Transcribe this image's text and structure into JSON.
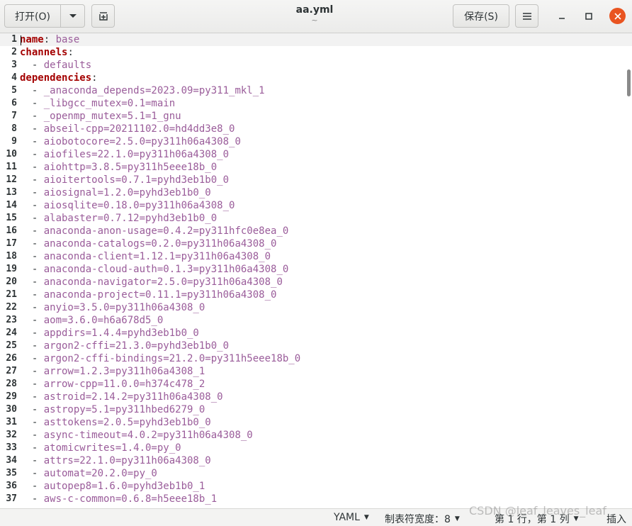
{
  "header": {
    "open_label": "打开(O)",
    "open_menu_icon": "chevron-down-icon",
    "new_tab_icon": "new-tab-icon",
    "title": "aa.yml",
    "subtitle": "~",
    "save_label": "保存(S)",
    "menu_icon": "hamburger-icon",
    "minimize_glyph": "—",
    "maximize_glyph": "☐",
    "close_glyph": "✕",
    "close_color": "#e95420"
  },
  "editor": {
    "lines": [
      {
        "n": "1",
        "type": "kv",
        "key": "name",
        "value": "base"
      },
      {
        "n": "2",
        "type": "key",
        "key": "channels"
      },
      {
        "n": "3",
        "type": "item",
        "value": "defaults"
      },
      {
        "n": "4",
        "type": "key",
        "key": "dependencies"
      },
      {
        "n": "5",
        "type": "item",
        "value": "_anaconda_depends=2023.09=py311_mkl_1"
      },
      {
        "n": "6",
        "type": "item",
        "value": "_libgcc_mutex=0.1=main"
      },
      {
        "n": "7",
        "type": "item",
        "value": "_openmp_mutex=5.1=1_gnu"
      },
      {
        "n": "8",
        "type": "item",
        "value": "abseil-cpp=20211102.0=hd4dd3e8_0"
      },
      {
        "n": "9",
        "type": "item",
        "value": "aiobotocore=2.5.0=py311h06a4308_0"
      },
      {
        "n": "10",
        "type": "item",
        "value": "aiofiles=22.1.0=py311h06a4308_0"
      },
      {
        "n": "11",
        "type": "item",
        "value": "aiohttp=3.8.5=py311h5eee18b_0"
      },
      {
        "n": "12",
        "type": "item",
        "value": "aioitertools=0.7.1=pyhd3eb1b0_0"
      },
      {
        "n": "13",
        "type": "item",
        "value": "aiosignal=1.2.0=pyhd3eb1b0_0"
      },
      {
        "n": "14",
        "type": "item",
        "value": "aiosqlite=0.18.0=py311h06a4308_0"
      },
      {
        "n": "15",
        "type": "item",
        "value": "alabaster=0.7.12=pyhd3eb1b0_0"
      },
      {
        "n": "16",
        "type": "item",
        "value": "anaconda-anon-usage=0.4.2=py311hfc0e8ea_0"
      },
      {
        "n": "17",
        "type": "item",
        "value": "anaconda-catalogs=0.2.0=py311h06a4308_0"
      },
      {
        "n": "18",
        "type": "item",
        "value": "anaconda-client=1.12.1=py311h06a4308_0"
      },
      {
        "n": "19",
        "type": "item",
        "value": "anaconda-cloud-auth=0.1.3=py311h06a4308_0"
      },
      {
        "n": "20",
        "type": "item",
        "value": "anaconda-navigator=2.5.0=py311h06a4308_0"
      },
      {
        "n": "21",
        "type": "item",
        "value": "anaconda-project=0.11.1=py311h06a4308_0"
      },
      {
        "n": "22",
        "type": "item",
        "value": "anyio=3.5.0=py311h06a4308_0"
      },
      {
        "n": "23",
        "type": "item",
        "value": "aom=3.6.0=h6a678d5_0"
      },
      {
        "n": "24",
        "type": "item",
        "value": "appdirs=1.4.4=pyhd3eb1b0_0"
      },
      {
        "n": "25",
        "type": "item",
        "value": "argon2-cffi=21.3.0=pyhd3eb1b0_0"
      },
      {
        "n": "26",
        "type": "item",
        "value": "argon2-cffi-bindings=21.2.0=py311h5eee18b_0"
      },
      {
        "n": "27",
        "type": "item",
        "value": "arrow=1.2.3=py311h06a4308_1"
      },
      {
        "n": "28",
        "type": "item",
        "value": "arrow-cpp=11.0.0=h374c478_2"
      },
      {
        "n": "29",
        "type": "item",
        "value": "astroid=2.14.2=py311h06a4308_0"
      },
      {
        "n": "30",
        "type": "item",
        "value": "astropy=5.1=py311hbed6279_0"
      },
      {
        "n": "31",
        "type": "item",
        "value": "asttokens=2.0.5=pyhd3eb1b0_0"
      },
      {
        "n": "32",
        "type": "item",
        "value": "async-timeout=4.0.2=py311h06a4308_0"
      },
      {
        "n": "33",
        "type": "item",
        "value": "atomicwrites=1.4.0=py_0"
      },
      {
        "n": "34",
        "type": "item",
        "value": "attrs=22.1.0=py311h06a4308_0"
      },
      {
        "n": "35",
        "type": "item",
        "value": "automat=20.2.0=py_0"
      },
      {
        "n": "36",
        "type": "item",
        "value": "autopep8=1.6.0=pyhd3eb1b0_1"
      },
      {
        "n": "37",
        "type": "item",
        "value": "aws-c-common=0.6.8=h5eee18b_1"
      }
    ]
  },
  "statusbar": {
    "language": "YAML",
    "tab_width": "制表符宽度：8",
    "position": "第 1 行，第 1 列",
    "mode": "插入",
    "dropdown_icon": "triangle-down-icon"
  },
  "watermark": "CSDN @leaf_leaves_leaf"
}
